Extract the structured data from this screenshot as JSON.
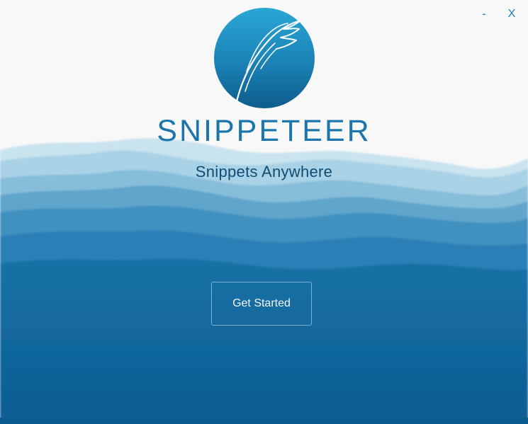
{
  "window_controls": {
    "minimize_label": "-",
    "close_label": "X"
  },
  "app": {
    "title": "SNIPPETEER",
    "tagline": "Snippets Anywhere"
  },
  "actions": {
    "get_started_label": "Get Started"
  },
  "colors": {
    "brand": "#1c76ad",
    "ocean_deep": "#0d5f94",
    "ocean_light": "#a9d2e6",
    "background": "#f8f8f8"
  },
  "icons": {
    "logo": "quill-feather-logo-icon"
  }
}
